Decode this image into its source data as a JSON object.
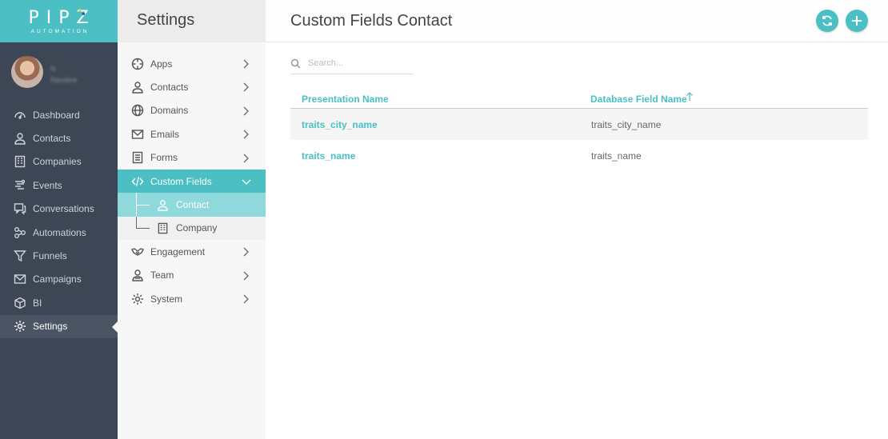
{
  "brand": {
    "name": "PIPZ",
    "tagline": "AUTOMATION"
  },
  "user": {
    "line1": "N",
    "line2": "Nandine"
  },
  "nav": [
    {
      "label": "Dashboard",
      "icon": "dashboard-icon"
    },
    {
      "label": "Contacts",
      "icon": "person-icon"
    },
    {
      "label": "Companies",
      "icon": "building-icon"
    },
    {
      "label": "Events",
      "icon": "events-icon"
    },
    {
      "label": "Conversations",
      "icon": "chat-icon"
    },
    {
      "label": "Automations",
      "icon": "automation-icon"
    },
    {
      "label": "Funnels",
      "icon": "funnel-icon"
    },
    {
      "label": "Campaigns",
      "icon": "mail-icon"
    },
    {
      "label": "BI",
      "icon": "cube-icon"
    },
    {
      "label": "Settings",
      "icon": "gear-icon",
      "active": true
    }
  ],
  "settings": {
    "title": "Settings",
    "items": [
      {
        "label": "Apps",
        "icon": "crosshair-icon"
      },
      {
        "label": "Contacts",
        "icon": "person-icon"
      },
      {
        "label": "Domains",
        "icon": "globe-icon"
      },
      {
        "label": "Emails",
        "icon": "mail-icon"
      },
      {
        "label": "Forms",
        "icon": "form-icon"
      },
      {
        "label": "Custom Fields",
        "icon": "code-icon",
        "expanded": true
      },
      {
        "label": "Engagement",
        "icon": "handshake-icon"
      },
      {
        "label": "Team",
        "icon": "team-icon"
      },
      {
        "label": "System",
        "icon": "gear-icon"
      }
    ],
    "custom_fields_children": [
      {
        "label": "Contact",
        "icon": "person-icon",
        "selected": true
      },
      {
        "label": "Company",
        "icon": "building-icon"
      }
    ]
  },
  "main": {
    "title": "Custom Fields Contact",
    "search_placeholder": "Search...",
    "columns": [
      "Presentation Name",
      "Database Field Name"
    ],
    "sorted_column": "Database Field Name",
    "sort_direction": "ascending",
    "rows": [
      {
        "presentation": "traits_city_name",
        "database": "traits_city_name"
      },
      {
        "presentation": "traits_name",
        "database": "traits_name"
      }
    ]
  },
  "colors": {
    "accent": "#4bbfc4",
    "sidebar": "#3d4654",
    "selected_sub": "#8fd8db"
  }
}
